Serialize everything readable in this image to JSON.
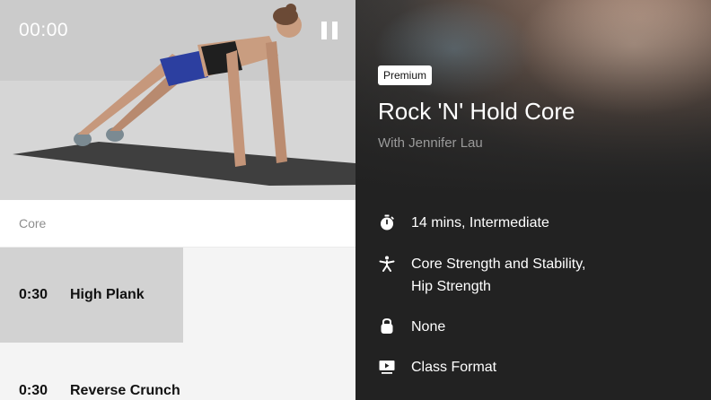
{
  "player": {
    "timer": "00:00"
  },
  "routine": {
    "section": "Core",
    "exercises": [
      {
        "time": "0:30",
        "name": "High Plank",
        "progress": 0.515
      },
      {
        "time": "0:30",
        "name": "Reverse Crunch",
        "progress": 0
      }
    ]
  },
  "class": {
    "badge": "Premium",
    "title": "Rock 'N' Hold Core",
    "instructor": "With Jennifer Lau",
    "details": [
      {
        "icon": "stopwatch-icon",
        "lines": [
          "14 mins, Intermediate"
        ]
      },
      {
        "icon": "person-stretch-icon",
        "lines": [
          "Core Strength and Stability,",
          "Hip Strength"
        ]
      },
      {
        "icon": "kettlebell-icon",
        "lines": [
          "None"
        ]
      },
      {
        "icon": "video-format-icon",
        "lines": [
          "Class Format"
        ]
      }
    ]
  },
  "colors": {
    "accent_text": "#ffffff",
    "progress_fill": "#d2d2d2",
    "row_bg": "#f4f4f4",
    "dark_bg": "#222222"
  }
}
